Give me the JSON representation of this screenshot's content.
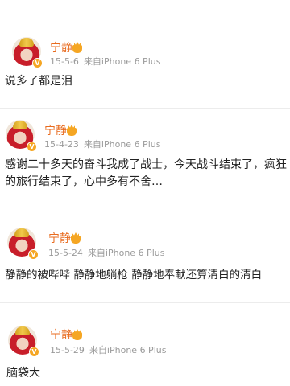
{
  "posts": [
    {
      "username": "宁静",
      "date": "15-5-6",
      "source": "来自iPhone 6 Plus",
      "text": "说多了都是泪"
    },
    {
      "username": "宁静",
      "date": "15-4-23",
      "source": "来自iPhone 6 Plus",
      "text": "感谢二十多天的奋斗我成了战士，今天战斗结束了，疯狂的旅行结束了，心中多有不舍…"
    },
    {
      "username": "宁静",
      "date": "15-5-24",
      "source": "来自iPhone 6 Plus",
      "text": "静静的被哔哔 静静地躺枪 静静地奉献还算清白的清白"
    },
    {
      "username": "宁静",
      "date": "15-5-29",
      "source": "来自iPhone 6 Plus",
      "text": "脑袋大"
    }
  ],
  "icons": {
    "verified_badge": "V",
    "vip_badge": "crown-icon"
  },
  "colors": {
    "username": "#e86b1f",
    "meta": "#9a9a9a",
    "badge": "#f5a623"
  }
}
